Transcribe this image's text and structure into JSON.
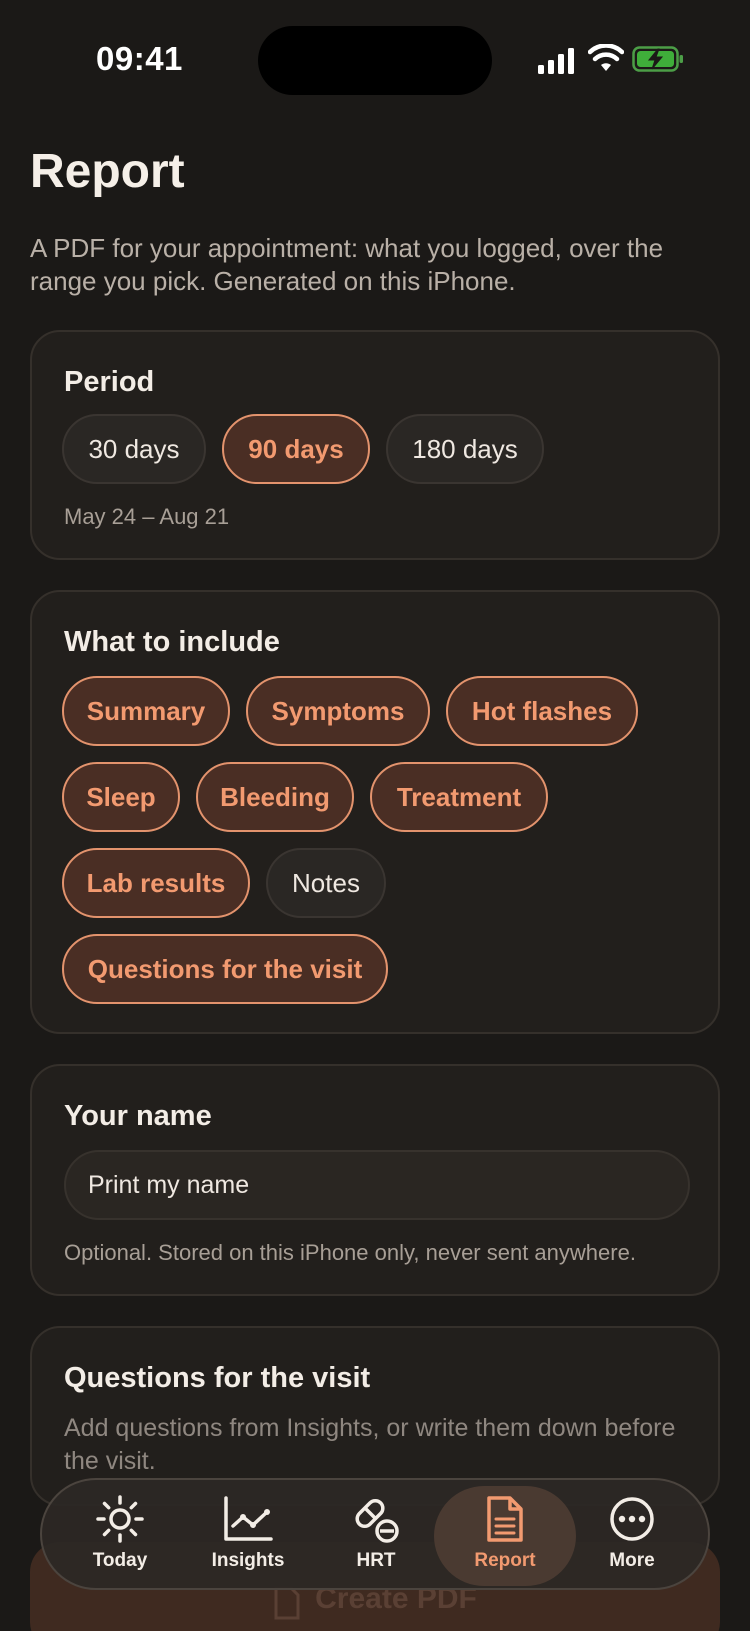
{
  "status_bar": {
    "time": "09:41"
  },
  "header": {
    "title": "Report",
    "subtitle": "A PDF for your appointment: what you logged, over the range you pick. Generated on this iPhone."
  },
  "period": {
    "title": "Period",
    "options": [
      {
        "label": "30 days",
        "selected": false
      },
      {
        "label": "90 days",
        "selected": true
      },
      {
        "label": "180 days",
        "selected": false
      }
    ],
    "range_text": "May 24 – Aug 21"
  },
  "include": {
    "title": "What to include",
    "options": [
      {
        "label": "Summary",
        "selected": true
      },
      {
        "label": "Symptoms",
        "selected": true
      },
      {
        "label": "Hot flashes",
        "selected": true
      },
      {
        "label": "Sleep",
        "selected": true
      },
      {
        "label": "Bleeding",
        "selected": true
      },
      {
        "label": "Treatment",
        "selected": true
      },
      {
        "label": "Lab results",
        "selected": true
      },
      {
        "label": "Notes",
        "selected": false
      },
      {
        "label": "Questions for the visit",
        "selected": true
      }
    ]
  },
  "name": {
    "title": "Your name",
    "placeholder": "Print my name",
    "note": "Optional. Stored on this iPhone only, never sent anywhere."
  },
  "questions": {
    "title": "Questions for the visit",
    "description": "Add questions from Insights, or write them down before the visit."
  },
  "create_button": {
    "label": "Create PDF",
    "icon": "document-icon"
  },
  "tabs": [
    {
      "label": "Today",
      "icon": "sun-icon",
      "active": false
    },
    {
      "label": "Insights",
      "icon": "chart-icon",
      "active": false
    },
    {
      "label": "HRT",
      "icon": "pill-icon",
      "active": false
    },
    {
      "label": "Report",
      "icon": "document-icon",
      "active": true
    },
    {
      "label": "More",
      "icon": "ellipsis-icon",
      "active": false
    }
  ],
  "colors": {
    "accent": "#f29a70",
    "background": "#1b1917",
    "card": "#221f1c"
  }
}
